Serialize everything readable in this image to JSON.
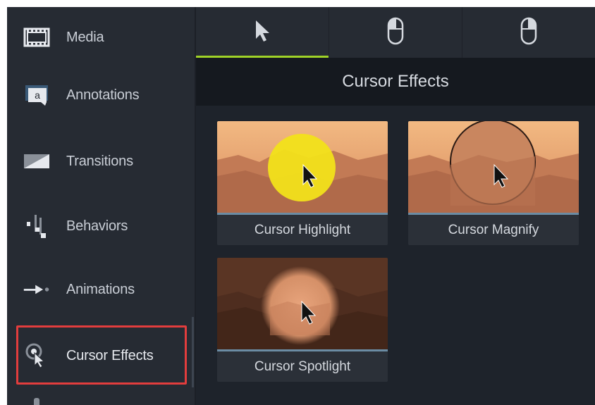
{
  "sidebar": {
    "items": [
      {
        "label": "Media",
        "icon": "film-strip-icon"
      },
      {
        "label": "Annotations",
        "icon": "annotation-callout-icon"
      },
      {
        "label": "Transitions",
        "icon": "transition-icon"
      },
      {
        "label": "Behaviors",
        "icon": "behaviors-icon"
      },
      {
        "label": "Animations",
        "icon": "animation-arrow-icon"
      },
      {
        "label": "Cursor Effects",
        "icon": "cursor-effects-icon"
      }
    ],
    "active": "Cursor Effects"
  },
  "tabs": [
    {
      "name": "cursor",
      "icon": "cursor-arrow-icon",
      "active": true
    },
    {
      "name": "left-click",
      "icon": "mouse-left-click-icon",
      "active": false
    },
    {
      "name": "right-click",
      "icon": "mouse-right-click-icon",
      "active": false
    }
  ],
  "panel": {
    "title": "Cursor Effects",
    "effects": [
      {
        "label": "Cursor Highlight"
      },
      {
        "label": "Cursor Magnify"
      },
      {
        "label": "Cursor Spotlight"
      }
    ]
  },
  "colors": {
    "accent": "#9fd227",
    "selection_outline": "#e23d3d",
    "highlight_yellow": "#f2e21a"
  }
}
